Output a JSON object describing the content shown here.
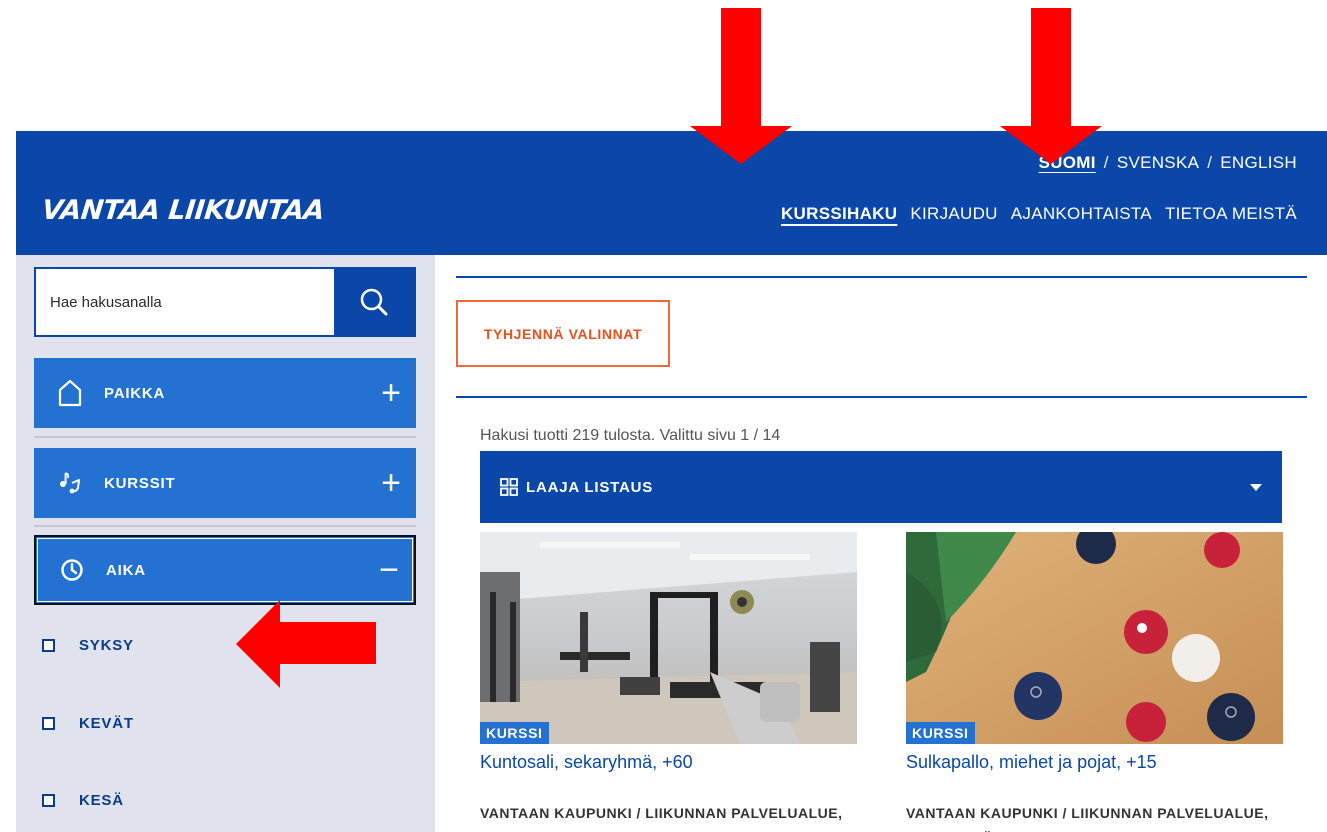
{
  "header": {
    "logo": "VANTAA LIIKUNTAA",
    "languages": [
      {
        "label": "SUOMI",
        "active": true
      },
      {
        "label": "SVENSKA",
        "active": false
      },
      {
        "label": "ENGLISH",
        "active": false
      }
    ],
    "lang_separator": "/",
    "nav": [
      {
        "label": "KURSSIHAKU",
        "active": true
      },
      {
        "label": "KIRJAUDU",
        "active": false
      },
      {
        "label": "AJANKOHTAISTA",
        "active": false
      },
      {
        "label": "TIETOA MEISTÄ",
        "active": false
      }
    ]
  },
  "sidebar": {
    "search_placeholder": "Hae hakusanalla",
    "categories": [
      {
        "label": "PAIKKA",
        "icon": "house-icon",
        "toggle": "+"
      },
      {
        "label": "KURSSIT",
        "icon": "music-note-icon",
        "toggle": "+"
      },
      {
        "label": "AIKA",
        "icon": "clock-icon",
        "toggle": "−"
      }
    ],
    "time_options": [
      "SYKSY",
      "KEVÄT",
      "KESÄ"
    ]
  },
  "main": {
    "clear_label": "TYHJENNÄ VALINNAT",
    "results_text": "Hakusi tuotti 219 tulosta. Valittu sivu 1 / 14",
    "listing_label": "LAAJA LISTAUS",
    "cards": [
      {
        "badge": "KURSSI",
        "title": "Kuntosali, sekaryhmä, +60",
        "org": "VANTAAN KAUPUNKI / LIIKUNNAN PALVELUALUE, HAKUNILAN SUURALUE,"
      },
      {
        "badge": "KURSSI",
        "title": "Sulkapallo, miehet ja pojat, +15",
        "org": "VANTAAN KAUPUNKI / LIIKUNNAN PALVELUALUE, KOIVUKYLÄN SUURALUE,"
      }
    ]
  },
  "colors": {
    "brand_blue": "#0a47a9",
    "category_blue": "#2372d2",
    "sidebar_bg": "#e0e3ed",
    "accent_orange": "#ee4f1a",
    "arrow_red": "#ff0000"
  }
}
